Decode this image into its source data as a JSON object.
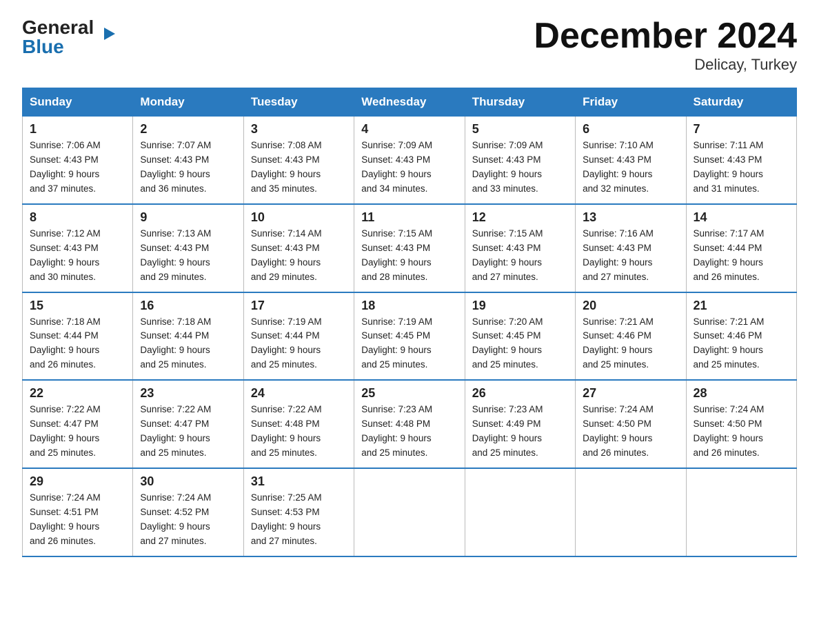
{
  "logo": {
    "general": "General",
    "blue": "Blue",
    "arrow": "▶"
  },
  "title": "December 2024",
  "subtitle": "Delicay, Turkey",
  "days_header": [
    "Sunday",
    "Monday",
    "Tuesday",
    "Wednesday",
    "Thursday",
    "Friday",
    "Saturday"
  ],
  "weeks": [
    [
      {
        "num": "1",
        "sunrise": "7:06 AM",
        "sunset": "4:43 PM",
        "daylight": "9 hours and 37 minutes."
      },
      {
        "num": "2",
        "sunrise": "7:07 AM",
        "sunset": "4:43 PM",
        "daylight": "9 hours and 36 minutes."
      },
      {
        "num": "3",
        "sunrise": "7:08 AM",
        "sunset": "4:43 PM",
        "daylight": "9 hours and 35 minutes."
      },
      {
        "num": "4",
        "sunrise": "7:09 AM",
        "sunset": "4:43 PM",
        "daylight": "9 hours and 34 minutes."
      },
      {
        "num": "5",
        "sunrise": "7:09 AM",
        "sunset": "4:43 PM",
        "daylight": "9 hours and 33 minutes."
      },
      {
        "num": "6",
        "sunrise": "7:10 AM",
        "sunset": "4:43 PM",
        "daylight": "9 hours and 32 minutes."
      },
      {
        "num": "7",
        "sunrise": "7:11 AM",
        "sunset": "4:43 PM",
        "daylight": "9 hours and 31 minutes."
      }
    ],
    [
      {
        "num": "8",
        "sunrise": "7:12 AM",
        "sunset": "4:43 PM",
        "daylight": "9 hours and 30 minutes."
      },
      {
        "num": "9",
        "sunrise": "7:13 AM",
        "sunset": "4:43 PM",
        "daylight": "9 hours and 29 minutes."
      },
      {
        "num": "10",
        "sunrise": "7:14 AM",
        "sunset": "4:43 PM",
        "daylight": "9 hours and 29 minutes."
      },
      {
        "num": "11",
        "sunrise": "7:15 AM",
        "sunset": "4:43 PM",
        "daylight": "9 hours and 28 minutes."
      },
      {
        "num": "12",
        "sunrise": "7:15 AM",
        "sunset": "4:43 PM",
        "daylight": "9 hours and 27 minutes."
      },
      {
        "num": "13",
        "sunrise": "7:16 AM",
        "sunset": "4:43 PM",
        "daylight": "9 hours and 27 minutes."
      },
      {
        "num": "14",
        "sunrise": "7:17 AM",
        "sunset": "4:44 PM",
        "daylight": "9 hours and 26 minutes."
      }
    ],
    [
      {
        "num": "15",
        "sunrise": "7:18 AM",
        "sunset": "4:44 PM",
        "daylight": "9 hours and 26 minutes."
      },
      {
        "num": "16",
        "sunrise": "7:18 AM",
        "sunset": "4:44 PM",
        "daylight": "9 hours and 25 minutes."
      },
      {
        "num": "17",
        "sunrise": "7:19 AM",
        "sunset": "4:44 PM",
        "daylight": "9 hours and 25 minutes."
      },
      {
        "num": "18",
        "sunrise": "7:19 AM",
        "sunset": "4:45 PM",
        "daylight": "9 hours and 25 minutes."
      },
      {
        "num": "19",
        "sunrise": "7:20 AM",
        "sunset": "4:45 PM",
        "daylight": "9 hours and 25 minutes."
      },
      {
        "num": "20",
        "sunrise": "7:21 AM",
        "sunset": "4:46 PM",
        "daylight": "9 hours and 25 minutes."
      },
      {
        "num": "21",
        "sunrise": "7:21 AM",
        "sunset": "4:46 PM",
        "daylight": "9 hours and 25 minutes."
      }
    ],
    [
      {
        "num": "22",
        "sunrise": "7:22 AM",
        "sunset": "4:47 PM",
        "daylight": "9 hours and 25 minutes."
      },
      {
        "num": "23",
        "sunrise": "7:22 AM",
        "sunset": "4:47 PM",
        "daylight": "9 hours and 25 minutes."
      },
      {
        "num": "24",
        "sunrise": "7:22 AM",
        "sunset": "4:48 PM",
        "daylight": "9 hours and 25 minutes."
      },
      {
        "num": "25",
        "sunrise": "7:23 AM",
        "sunset": "4:48 PM",
        "daylight": "9 hours and 25 minutes."
      },
      {
        "num": "26",
        "sunrise": "7:23 AM",
        "sunset": "4:49 PM",
        "daylight": "9 hours and 25 minutes."
      },
      {
        "num": "27",
        "sunrise": "7:24 AM",
        "sunset": "4:50 PM",
        "daylight": "9 hours and 26 minutes."
      },
      {
        "num": "28",
        "sunrise": "7:24 AM",
        "sunset": "4:50 PM",
        "daylight": "9 hours and 26 minutes."
      }
    ],
    [
      {
        "num": "29",
        "sunrise": "7:24 AM",
        "sunset": "4:51 PM",
        "daylight": "9 hours and 26 minutes."
      },
      {
        "num": "30",
        "sunrise": "7:24 AM",
        "sunset": "4:52 PM",
        "daylight": "9 hours and 27 minutes."
      },
      {
        "num": "31",
        "sunrise": "7:25 AM",
        "sunset": "4:53 PM",
        "daylight": "9 hours and 27 minutes."
      },
      null,
      null,
      null,
      null
    ]
  ]
}
